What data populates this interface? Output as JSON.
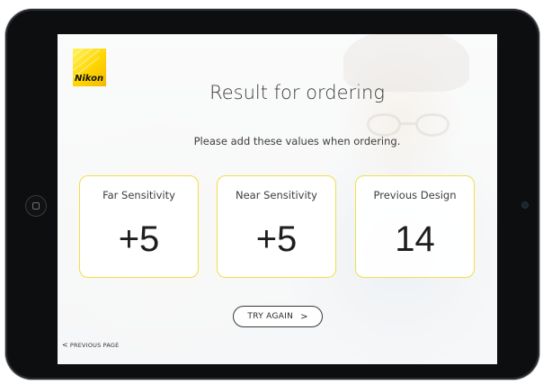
{
  "brand": {
    "logo_text": "Nikon",
    "accent_color": "#ffd400"
  },
  "header": {
    "title": "Result for ordering",
    "subtitle": "Please add these values when ordering."
  },
  "results": [
    {
      "label": "Far Sensitivity",
      "value": "+5"
    },
    {
      "label": "Near Sensitivity",
      "value": "+5"
    },
    {
      "label": "Previous Design",
      "value": "14"
    }
  ],
  "actions": {
    "try_again_label": "TRY AGAIN",
    "try_again_icon": "chevron-right-icon",
    "previous_page_label": "PREVIOUS PAGE",
    "previous_page_icon": "chevron-left-icon"
  },
  "colors": {
    "card_border": "#f2de4a",
    "text": "#3d3d3d"
  }
}
